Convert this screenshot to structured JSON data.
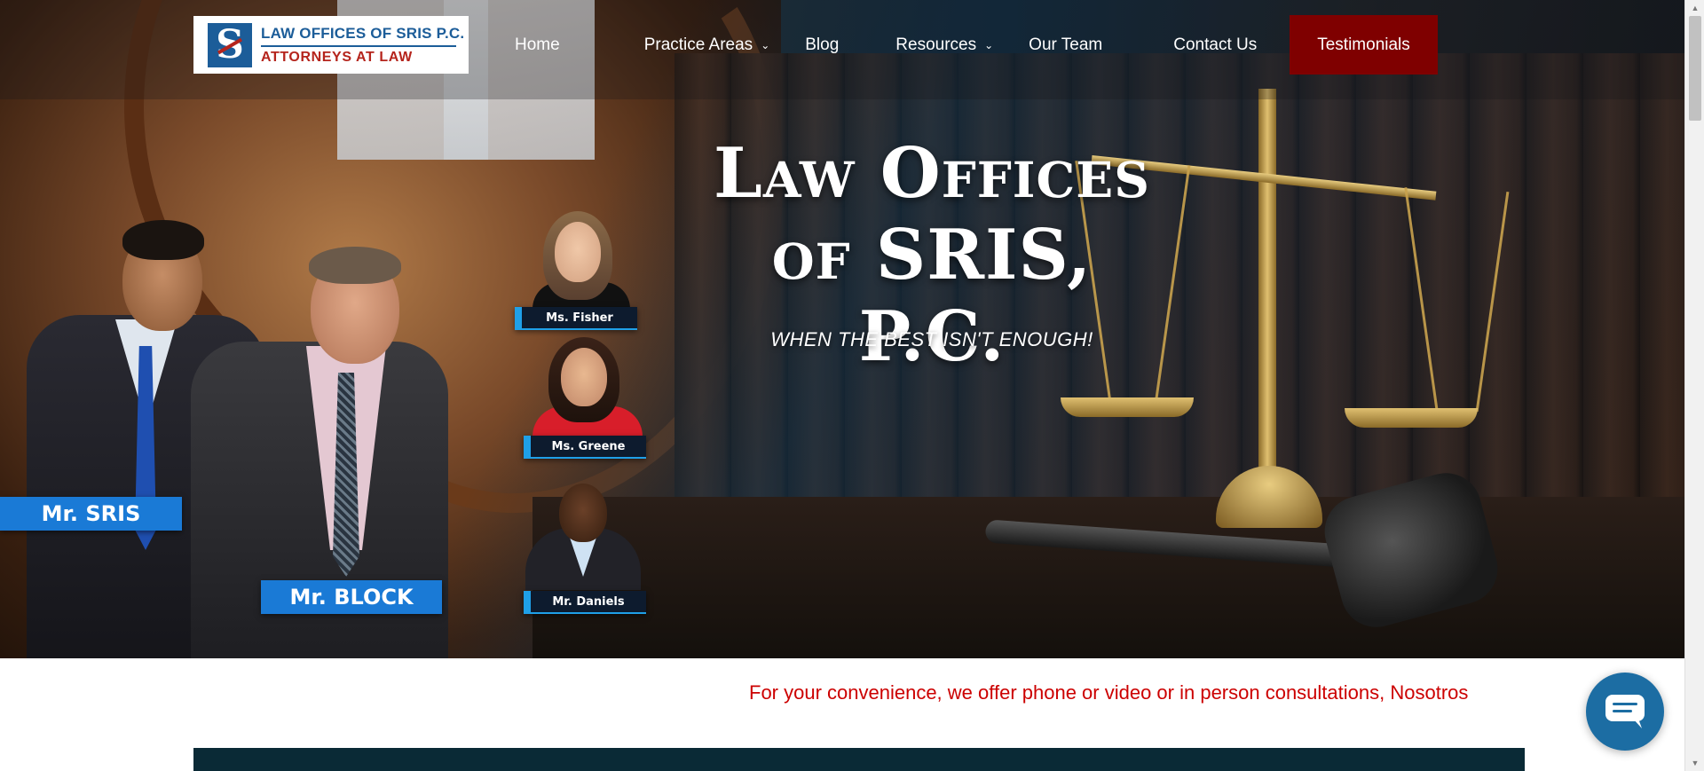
{
  "logo": {
    "line1": "LAW OFFICES OF SRIS P.C.",
    "line2": "ATTORNEYS AT LAW",
    "mark": "S"
  },
  "nav": {
    "items": [
      {
        "label": "Home"
      },
      {
        "label": "Practice Areas",
        "has_dropdown": true
      },
      {
        "label": "Blog"
      },
      {
        "label": "Resources",
        "has_dropdown": true
      },
      {
        "label": "Our Team"
      },
      {
        "label": "Contact Us"
      },
      {
        "label": "Testimonials",
        "highlighted": true
      }
    ]
  },
  "hero": {
    "headline_line1": "Law Offices",
    "headline_line2": "of SRIS, P.C.",
    "tagline": "WHEN THE BEST ISN'T ENOUGH!",
    "attorneys": [
      {
        "name": "Mr. SRIS"
      },
      {
        "name": "Mr. BLOCK"
      },
      {
        "name": "Ms. Fisher"
      },
      {
        "name": "Ms. Greene"
      },
      {
        "name": "Mr. Daniels"
      }
    ]
  },
  "notice": "For your convenience, we offer phone or video or in person consultations, Nosotros",
  "colors": {
    "brand_blue": "#1c5d99",
    "brand_red": "#b5241c",
    "cta_red": "#7f0000",
    "notice_red": "#cc0000",
    "chat_blue": "#1c6da3"
  },
  "icons": {
    "chat": "chat-bubble-icon",
    "dropdown": "chevron-down-icon"
  }
}
